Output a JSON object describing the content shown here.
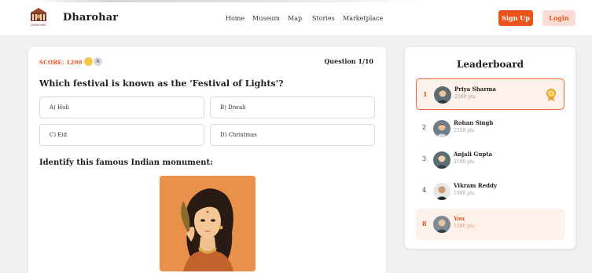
{
  "header": {
    "logo_text": "DHAROHAR",
    "brand": "Dharohar",
    "nav": [
      "Home",
      "Museum",
      "Map",
      "Stories",
      "Marketplace"
    ],
    "signup_label": "Sign Up",
    "login_label": "Login"
  },
  "quiz": {
    "score_label": "SCORE: 1200",
    "badge_letter": "N",
    "question_counter": "Question 1/10",
    "question": "Which festival is known as the 'Festival of Lights'?",
    "options": [
      "A) Holi",
      "B) Diwali",
      "C) Eid",
      "D) Christmas"
    ],
    "image_question": "Identify this famous Indian monument:"
  },
  "leaderboard": {
    "title": "Leaderboard",
    "entries": [
      {
        "rank": "1",
        "name": "Priya Sharma",
        "points": "2500 pts"
      },
      {
        "rank": "2",
        "name": "Rohan Singh",
        "points": "2350 pts"
      },
      {
        "rank": "3",
        "name": "Anjali Gupta",
        "points": "2100 pts"
      },
      {
        "rank": "4",
        "name": "Vikram Reddy",
        "points": "1980 pts"
      },
      {
        "rank": "8",
        "name": "You",
        "points": "1500 pts"
      }
    ]
  },
  "colors": {
    "accent": "#e8541c",
    "accent_light": "#fdf1ec",
    "image_bg": "#e9904a"
  }
}
